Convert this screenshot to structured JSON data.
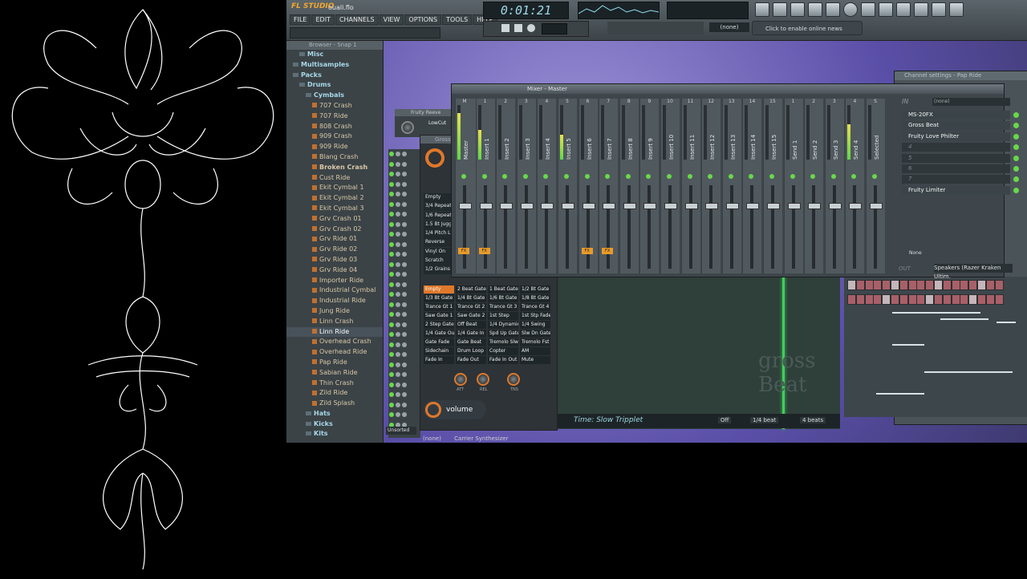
{
  "app": {
    "logo": "FL STUDIO",
    "project": "ouali.flo",
    "menu": [
      "FILE",
      "EDIT",
      "CHANNELS",
      "VIEW",
      "OPTIONS",
      "TOOLS",
      "HELP"
    ],
    "time": "0:01:21",
    "pattern": "(none)",
    "news": "Click to enable online news"
  },
  "browser": {
    "title": "Browser - Snap 1",
    "items": [
      {
        "label": "Misc",
        "type": "folder",
        "indent": 2
      },
      {
        "label": "Multisamples",
        "type": "folder",
        "indent": 1
      },
      {
        "label": "Packs",
        "type": "folder",
        "indent": 1
      },
      {
        "label": "Drums",
        "type": "folder",
        "indent": 2
      },
      {
        "label": "Cymbals",
        "type": "folder",
        "indent": 3
      },
      {
        "label": "707 Crash",
        "type": "file",
        "indent": 4
      },
      {
        "label": "707 Ride",
        "type": "file",
        "indent": 4
      },
      {
        "label": "808 Crash",
        "type": "file",
        "indent": 4
      },
      {
        "label": "909 Crash",
        "type": "file",
        "indent": 4
      },
      {
        "label": "909 Ride",
        "type": "file",
        "indent": 4
      },
      {
        "label": "Blang Crash",
        "type": "file",
        "indent": 4
      },
      {
        "label": "Broken Crash",
        "type": "file",
        "indent": 4,
        "bold": true
      },
      {
        "label": "Cust Ride",
        "type": "file",
        "indent": 4
      },
      {
        "label": "Ekit Cymbal 1",
        "type": "file",
        "indent": 4
      },
      {
        "label": "Ekit Cymbal 2",
        "type": "file",
        "indent": 4
      },
      {
        "label": "Ekit Cymbal 3",
        "type": "file",
        "indent": 4
      },
      {
        "label": "Grv Crash 01",
        "type": "file",
        "indent": 4
      },
      {
        "label": "Grv Crash 02",
        "type": "file",
        "indent": 4
      },
      {
        "label": "Grv Ride 01",
        "type": "file",
        "indent": 4
      },
      {
        "label": "Grv Ride 02",
        "type": "file",
        "indent": 4
      },
      {
        "label": "Grv Ride 03",
        "type": "file",
        "indent": 4
      },
      {
        "label": "Grv Ride 04",
        "type": "file",
        "indent": 4
      },
      {
        "label": "Importer Ride",
        "type": "file",
        "indent": 4
      },
      {
        "label": "Industrial Cymbal",
        "type": "file",
        "indent": 4
      },
      {
        "label": "Industrial Ride",
        "type": "file",
        "indent": 4
      },
      {
        "label": "Jung Ride",
        "type": "file",
        "indent": 4
      },
      {
        "label": "Linn Crash",
        "type": "file",
        "indent": 4
      },
      {
        "label": "Linn Ride",
        "type": "file",
        "indent": 4,
        "selected": true
      },
      {
        "label": "Overhead Crash",
        "type": "file",
        "indent": 4
      },
      {
        "label": "Overhead Ride",
        "type": "file",
        "indent": 4
      },
      {
        "label": "Pap Ride",
        "type": "file",
        "indent": 4
      },
      {
        "label": "Sabian Ride",
        "type": "file",
        "indent": 4
      },
      {
        "label": "Thin Crash",
        "type": "file",
        "indent": 4
      },
      {
        "label": "Zild Ride",
        "type": "file",
        "indent": 4
      },
      {
        "label": "Zild Splash",
        "type": "file",
        "indent": 4
      },
      {
        "label": "Hats",
        "type": "folder",
        "indent": 3
      },
      {
        "label": "Kicks",
        "type": "folder",
        "indent": 3
      },
      {
        "label": "Kits",
        "type": "folder",
        "indent": 3
      }
    ],
    "unsorted": "Unsorted"
  },
  "reverb": {
    "title": "Fruity Reeve",
    "lowcut": "LowCut"
  },
  "grossbeat": {
    "title": "Gross",
    "left_presets": [
      "Empty",
      "3/4 Repeat",
      "1/6 Repeat",
      "1.5 Bt Jugg",
      "1/4 Pitch L",
      "Reverse",
      "Vinyl On",
      "Scratch",
      "1/2 Grains"
    ],
    "presets": [
      "Empty",
      "2 Beat Gate",
      "1 Beat Gate",
      "1/2 Bt Gate",
      "1/3 Bt Gate",
      "1/4 Bt Gate",
      "1/6 Bt Gate",
      "1/8 Bt Gate",
      "Trance Gt 1",
      "Trance Gt 2",
      "Trance Gt 3",
      "Trance Gt 4",
      "Saw Gate 1",
      "Saw Gate 2",
      "1st Step",
      "1st Stp Fade",
      "2 Step Gate",
      "Off Beat",
      "1/4 Dynamic",
      "1/4 Swing",
      "1/4 Gate Out",
      "1/4 Gate In",
      "Spd Up Gate",
      "Slw Dn Gate",
      "Gate Fade",
      "Gate Beat",
      "Tremolo Slw",
      "Tremolo Fst",
      "Sidechain",
      "Drum Loop",
      "Copter",
      "AM",
      "Fade In",
      "Fade Out",
      "Fade In Out",
      "Mute"
    ],
    "knobs": [
      "ATT",
      "REL",
      "TNS"
    ],
    "volume": "volume",
    "time_label": "Time: Slow Tripplet",
    "hold": "Off",
    "time_step": "1/4 beat",
    "pattern_step": "4 beats",
    "watermark": "gross Beat"
  },
  "mixer": {
    "title": "Mixer - Master",
    "strips": [
      {
        "label": "Master",
        "num": "M",
        "level": 0.85,
        "fx": true
      },
      {
        "label": "Insert 1",
        "num": "1",
        "level": 0.55,
        "fx": true
      },
      {
        "label": "Insert 2",
        "num": "2",
        "level": 0.0
      },
      {
        "label": "Insert 3",
        "num": "3",
        "level": 0.0
      },
      {
        "label": "Insert 4",
        "num": "4",
        "level": 0.0
      },
      {
        "label": "Insert 5",
        "num": "5",
        "level": 0.45
      },
      {
        "label": "Insert 6",
        "num": "6",
        "level": 0.0,
        "fx": true
      },
      {
        "label": "Insert 7",
        "num": "7",
        "level": 0.0,
        "fx": true
      },
      {
        "label": "Insert 8",
        "num": "8",
        "level": 0.0
      },
      {
        "label": "Insert 9",
        "num": "9",
        "level": 0.0
      },
      {
        "label": "Insert 10",
        "num": "10",
        "level": 0.0
      },
      {
        "label": "Insert 11",
        "num": "11",
        "level": 0.0
      },
      {
        "label": "Insert 12",
        "num": "12",
        "level": 0.0
      },
      {
        "label": "Insert 13",
        "num": "13",
        "level": 0.0
      },
      {
        "label": "Insert 14",
        "num": "14",
        "level": 0.0
      },
      {
        "label": "Insert 15",
        "num": "15",
        "level": 0.0
      },
      {
        "label": "Send 1",
        "num": "1",
        "level": 0.0
      },
      {
        "label": "Send 2",
        "num": "2",
        "level": 0.0
      },
      {
        "label": "Send 3",
        "num": "3",
        "level": 0.0
      },
      {
        "label": "Send 4",
        "num": "4",
        "level": 0.65
      },
      {
        "label": "Selected",
        "num": "S",
        "level": 0.0
      }
    ],
    "input": "IN",
    "input_value": "(none)",
    "slots": [
      {
        "label": "MS-20FX",
        "state": "filled"
      },
      {
        "label": "Gross Beat",
        "state": "filled"
      },
      {
        "label": "Fruity Love Philter",
        "state": "filled"
      },
      {
        "label": "4",
        "state": "empty"
      },
      {
        "label": "5",
        "state": "empty"
      },
      {
        "label": "6",
        "state": "empty"
      },
      {
        "label": "7",
        "state": "empty"
      },
      {
        "label": "Fruity Limiter",
        "state": "filled"
      }
    ],
    "eq_none": "None",
    "output": "OUT",
    "output_value": "Speakers (Razer Kraken Ultim."
  },
  "channel_settings": {
    "title": "Channel settings - Pap Ride"
  },
  "bottom_channel": "(none)",
  "bottom_synth": "Carrier Synthesizer"
}
